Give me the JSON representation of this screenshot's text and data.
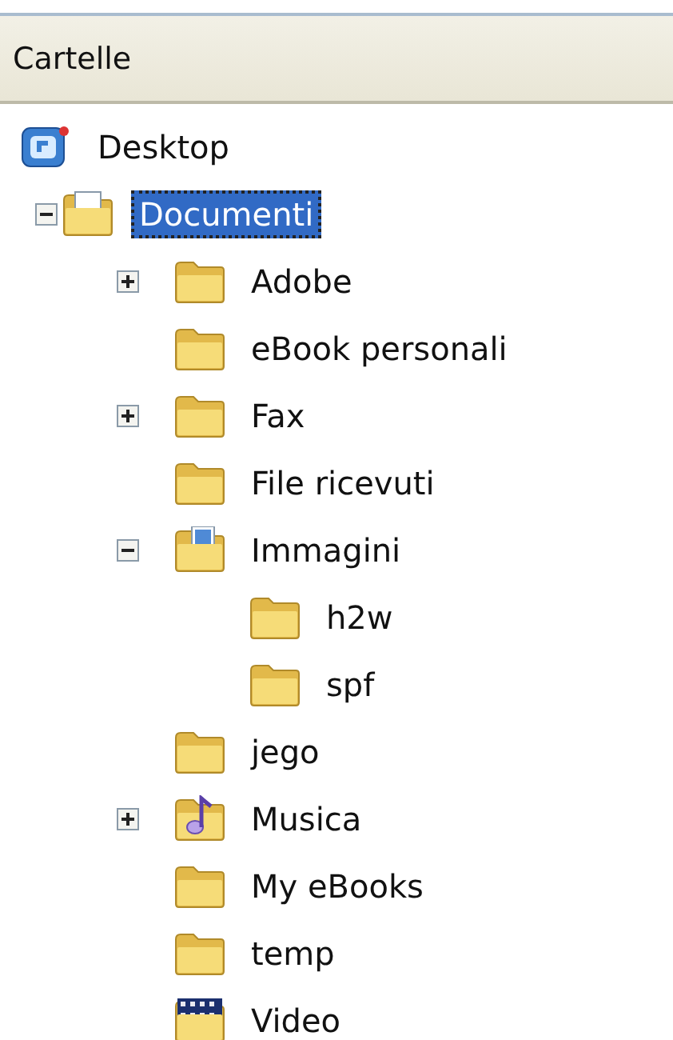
{
  "pane": {
    "title": "Cartelle"
  },
  "tree": [
    {
      "label": "Desktop",
      "kind": "desktop",
      "selected": false,
      "children": [
        {
          "label": "Documenti",
          "kind": "documents",
          "selected": true,
          "expanded": true,
          "children": [
            {
              "label": "Adobe",
              "kind": "folder",
              "selected": false,
              "expanded": false
            },
            {
              "label": "eBook personali",
              "kind": "folder",
              "selected": false
            },
            {
              "label": "Fax",
              "kind": "folder",
              "selected": false,
              "expanded": false
            },
            {
              "label": "File ricevuti",
              "kind": "folder",
              "selected": false
            },
            {
              "label": "Immagini",
              "kind": "pictures",
              "selected": false,
              "expanded": true,
              "children": [
                {
                  "label": "h2w",
                  "kind": "folder",
                  "selected": false
                },
                {
                  "label": "spf",
                  "kind": "folder",
                  "selected": false
                }
              ]
            },
            {
              "label": "jego",
              "kind": "folder",
              "selected": false
            },
            {
              "label": "Musica",
              "kind": "music",
              "selected": false,
              "expanded": false
            },
            {
              "label": "My eBooks",
              "kind": "folder",
              "selected": false
            },
            {
              "label": "temp",
              "kind": "folder",
              "selected": false
            },
            {
              "label": "Video",
              "kind": "video",
              "selected": false
            }
          ]
        }
      ]
    }
  ]
}
